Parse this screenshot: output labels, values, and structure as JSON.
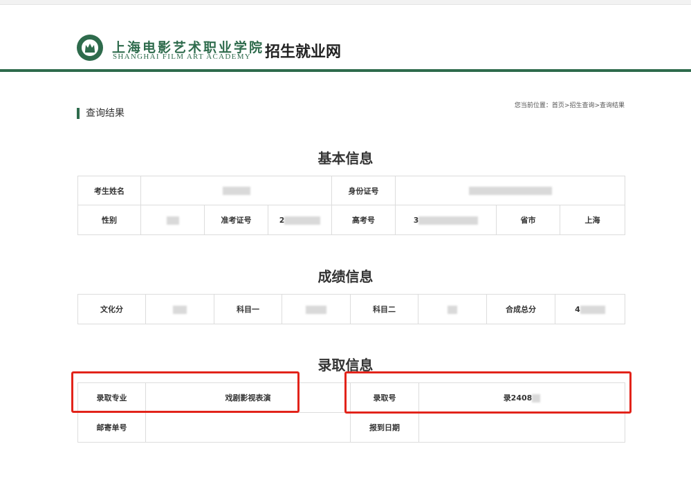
{
  "header": {
    "school_cn": "上海电影艺术职业学院",
    "school_en": "SHANGHAI FILM ART ACADEMY",
    "site_name": "招生就业网",
    "logo_icon": "crown-emblem-icon",
    "brand_color": "#2e6b4c"
  },
  "page": {
    "section_title": "查询结果",
    "breadcrumb": "您当前位置：首页>招生查询>查询结果"
  },
  "basic": {
    "title": "基本信息",
    "name_label": "考生姓名",
    "id_label": "身份证号",
    "gender_label": "性别",
    "ticket_label": "准考证号",
    "ticket_value_prefix": "2",
    "gaokao_label": "高考号",
    "gaokao_value_prefix": "3",
    "province_label": "省市",
    "province_value": "上海"
  },
  "scores": {
    "title": "成绩信息",
    "culture_label": "文化分",
    "subject1_label": "科目一",
    "subject2_label": "科目二",
    "total_label": "合成总分",
    "total_value_prefix": "4"
  },
  "admission": {
    "title": "录取信息",
    "major_label": "录取专业",
    "major_value": "戏剧影视表演",
    "number_label": "录取号",
    "number_value": "录2408",
    "mail_label": "邮寄单号",
    "report_label": "报到日期",
    "highlight_color": "#e2231a"
  }
}
